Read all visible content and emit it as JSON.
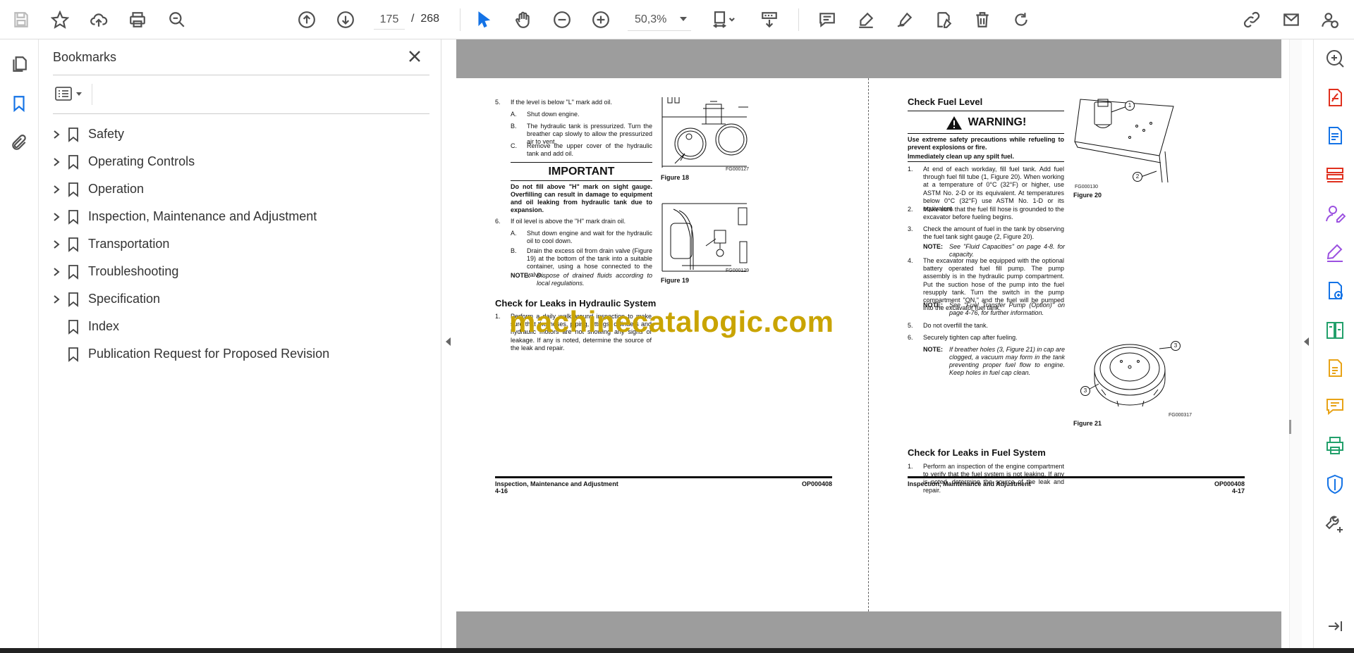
{
  "toolbar": {
    "current_page": "175",
    "page_separator": "/",
    "total_pages": "268",
    "zoom": "50,3%"
  },
  "bookmarks": {
    "title": "Bookmarks",
    "items": [
      {
        "label": "Safety",
        "expandable": true
      },
      {
        "label": "Operating Controls",
        "expandable": true
      },
      {
        "label": "Operation",
        "expandable": true
      },
      {
        "label": "Inspection, Maintenance and Adjustment",
        "expandable": true
      },
      {
        "label": "Transportation",
        "expandable": true
      },
      {
        "label": "Troubleshooting",
        "expandable": true
      },
      {
        "label": "Specification",
        "expandable": true
      },
      {
        "label": "Index",
        "expandable": false
      },
      {
        "label": "Publication Request for Proposed Revision",
        "expandable": false
      }
    ]
  },
  "left_page": {
    "s5_num": "5.",
    "s5_text": "If the level is below \"L\" mark add oil.",
    "s5a_num": "A.",
    "s5a_text": "Shut down engine.",
    "s5b_num": "B.",
    "s5b_text": "The hydraulic tank is pressurized. Turn the breather cap slowly to allow the pressurized air to vent.",
    "s5c_num": "C.",
    "s5c_text": "Remove the upper cover of the hydraulic tank and add oil.",
    "important_title": "IMPORTANT",
    "important_text": "Do not fill above \"H\" mark on sight gauge. Overfilling can result in damage to equipment and oil leaking from hydraulic tank due to expansion.",
    "s6_num": "6.",
    "s6_text": "If oil level is above the \"H\" mark drain oil.",
    "s6a_num": "A.",
    "s6a_text": "Shut down engine and wait for the hydraulic oil to cool down.",
    "s6b_num": "B.",
    "s6b_text": "Drain the excess oil from drain valve (Figure 19) at the bottom of the tank into a suitable container, using a hose connected to the valve.",
    "note_label": "NOTE:",
    "note_text": "Dispose of drained fluids according to local regulations.",
    "fig18_code": "FG000127",
    "fig18_caption": "Figure 18",
    "fig19_code": "FG000129",
    "fig19_caption": "Figure 19",
    "leaks_heading": "Check for Leaks in Hydraulic System",
    "leaks1_num": "1.",
    "leaks1_text": "Perform a daily walk-around inspection to make sure that the hoses, piping, fittings, cylinders and hydraulic motors are not showing any signs of leakage. If any is noted, determine the source of the leak and repair.",
    "footer_title": "Inspection, Maintenance and Adjustment",
    "footer_page": "4-16",
    "footer_code": "OP000408"
  },
  "right_page": {
    "heading": "Check Fuel Level",
    "warning_title": "WARNING!",
    "warning_text1": "Use extreme safety precautions while refueling to prevent explosions or fire.",
    "warning_text2": "Immediately clean up any spilt fuel.",
    "s1_num": "1.",
    "s1_text": "At end of each workday, fill fuel tank. Add fuel through fuel fill tube (1, Figure 20). When working at a temperature of 0°C (32°F) or higher, use ASTM No. 2-D or its equivalent. At temperatures below 0°C (32°F) use ASTM No. 1-D or its equivalent.",
    "s2_num": "2.",
    "s2_text": "Make sure that the fuel fill hose is grounded to the excavator before fueling begins.",
    "s3_num": "3.",
    "s3_text": "Check the amount of fuel in the tank by observing the fuel tank sight gauge (2, Figure 20).",
    "note1_label": "NOTE:",
    "note1_text": "See \"Fluid Capacities\" on page 4-8. for capacity.",
    "s4_num": "4.",
    "s4_text": "The excavator may be equipped with the optional battery operated fuel fill pump. The pump assembly is in the hydraulic pump compartment. Put the suction hose of the pump into the fuel resupply tank. Turn the switch in the pump compartment \"ON,\" and the fuel will be pumped into the excavator fuel tank.",
    "note2_label": "NOTE:",
    "note2_text": "See \"Fuel Transfer Pump (Option)\" on page 4-76, for further information.",
    "s5_num": "5.",
    "s5_text": "Do not overfill the tank.",
    "s6_num": "6.",
    "s6_text": "Securely tighten cap after fueling.",
    "note3_label": "NOTE:",
    "note3_text": "If breather holes (3, Figure 21) in cap are clogged, a vacuum may form in the tank preventing proper fuel flow to engine. Keep holes in fuel cap clean.",
    "fig20_code": "FG000130",
    "fig20_caption": "Figure 20",
    "fig21_code": "FG000317",
    "fig21_caption": "Figure 21",
    "callout1": "1",
    "callout2": "2",
    "callout3a": "3",
    "callout3b": "3",
    "leaks_heading": "Check for Leaks in Fuel System",
    "leaks1_num": "1.",
    "leaks1_text": "Perform an inspection of the engine compartment to verify that the fuel system is not leaking. If any is noted, determine the source of the leak and repair.",
    "footer_title": "Inspection, Maintenance and Adjustment",
    "footer_page": "4-17",
    "footer_code": "OP000408"
  },
  "watermark": "machinecatalogic.com",
  "colors": {
    "accent_blue": "#1473e6",
    "watermark": "#c9a400",
    "rail_red": "#e0301e",
    "rail_purple": "#9b51e0"
  }
}
